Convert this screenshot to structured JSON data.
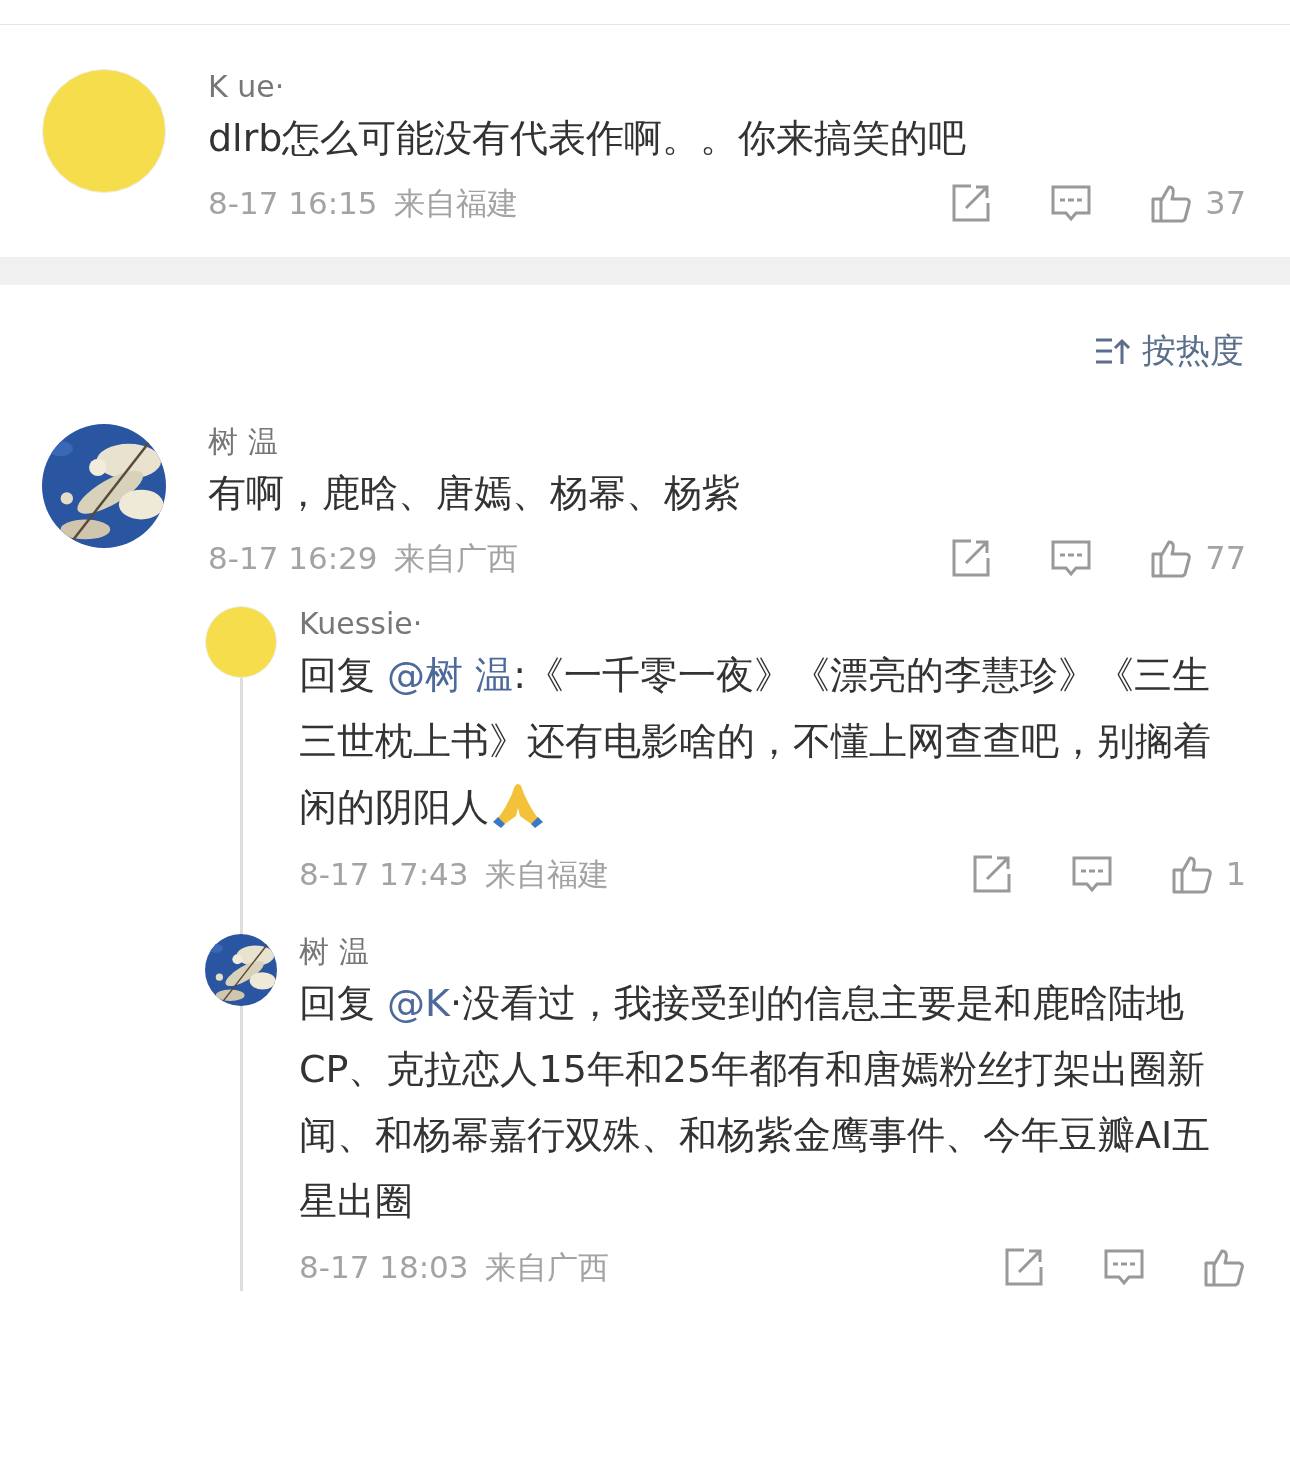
{
  "top_comment": {
    "avatar": {
      "kind": "plain"
    },
    "author": "K ue·",
    "text": "dlrb怎么可能没有代表作啊。。你来搞笑的吧",
    "time": "8-17 16:15",
    "location": "来自福建",
    "likes": "37"
  },
  "sort": {
    "label": "按热度"
  },
  "thread": {
    "author": "树 温",
    "text": "有啊，鹿晗、唐嫣、杨幂、杨紫",
    "time": "8-17 16:29",
    "location": "来自广西",
    "likes": "77",
    "replies": [
      {
        "avatar": {
          "kind": "plain"
        },
        "author": "Kuessie·",
        "prefix": "回复",
        "mention": "@树 温",
        "text": ":《一千零一夜》《漂亮的李慧珍》《三生三世枕上书》还有电影啥的，不懂上网查查吧，别搁着闲的阴阳人",
        "emoji": true,
        "time": "8-17 17:43",
        "location": "来自福建",
        "likes": "1"
      },
      {
        "author": "树 温",
        "prefix": "回复",
        "mention": "@K",
        "text": "·没看过，我接受到的信息主要是和鹿晗陆地CP、克拉恋人15年和25年都有和唐嫣粉丝打架出圈新闻、和杨幂嘉行双殊、和杨紫金鹰事件、今年豆瓣AI五星出圈",
        "emoji": false,
        "time": "8-17 18:03",
        "location": "来自广西"
      }
    ]
  }
}
